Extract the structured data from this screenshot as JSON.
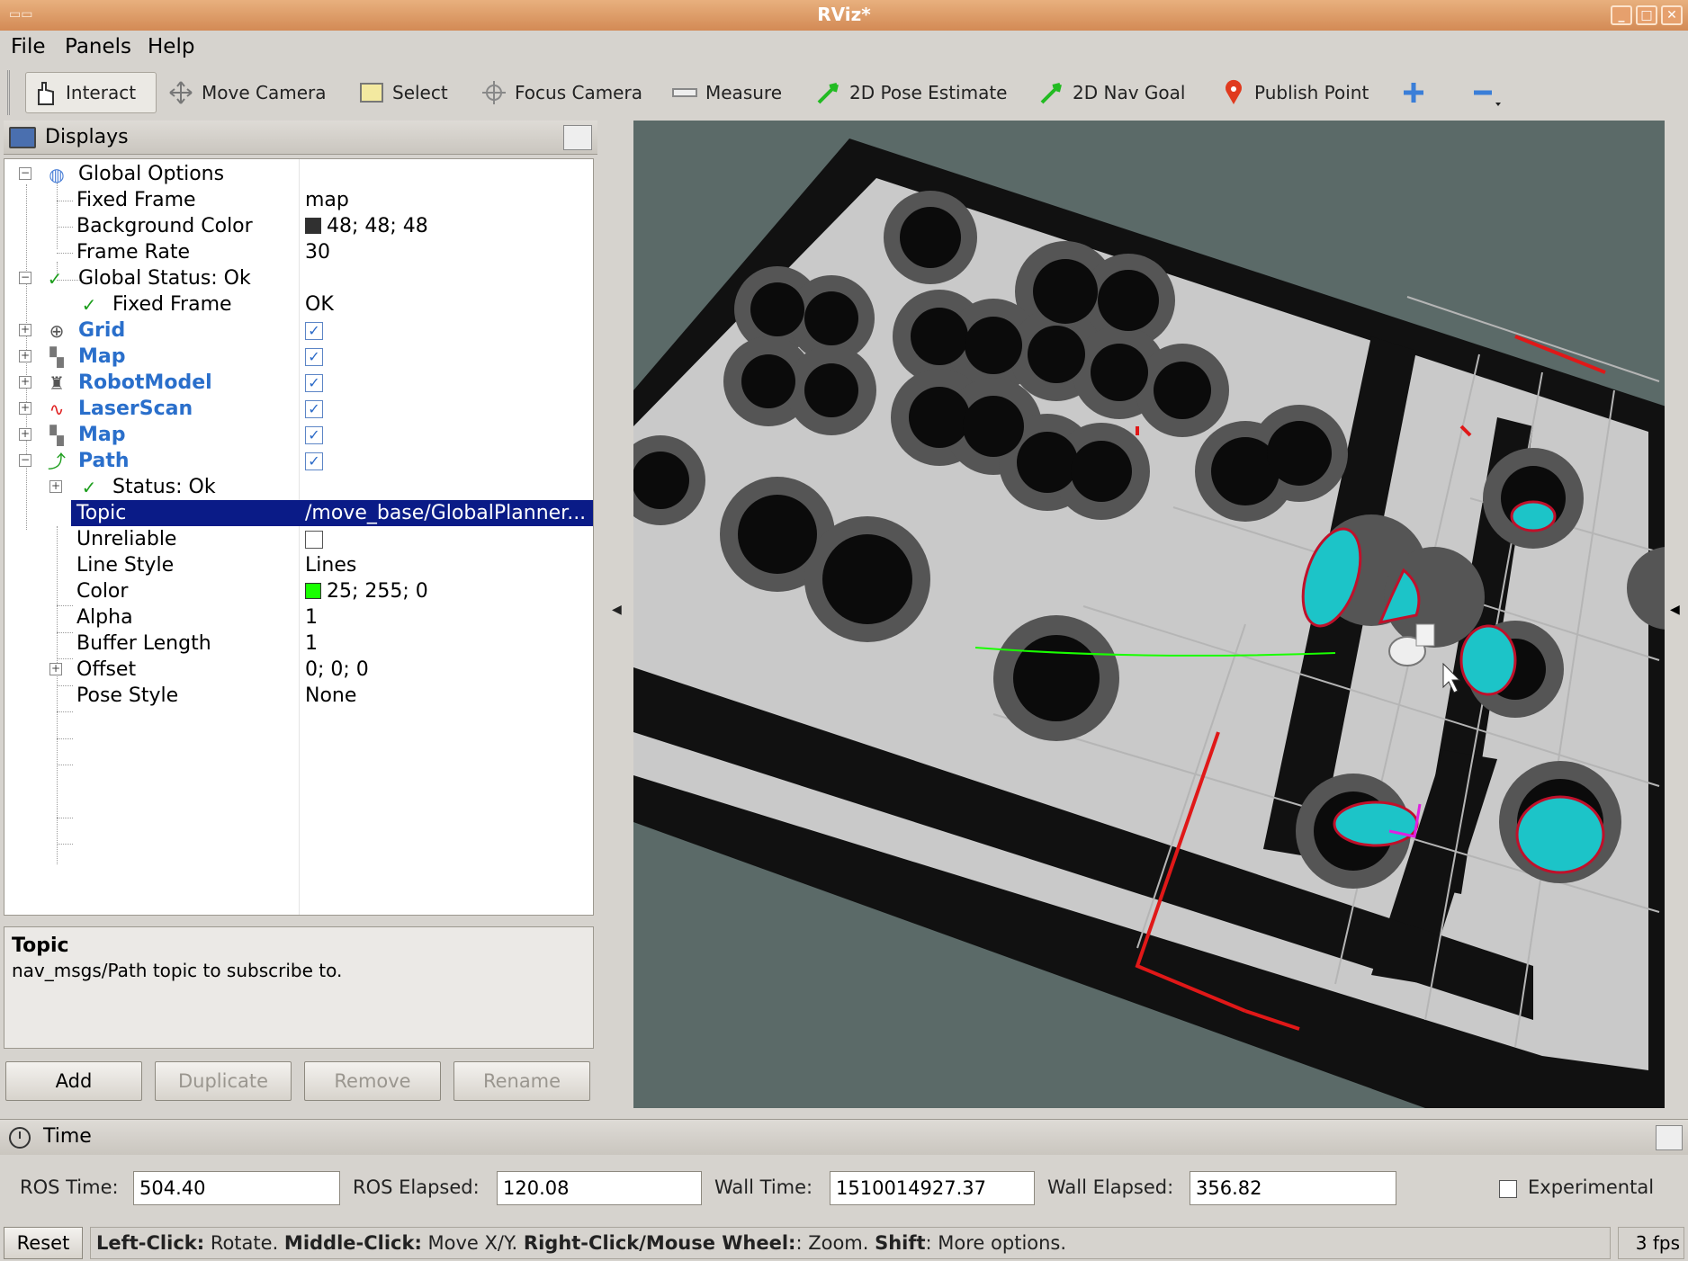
{
  "window": {
    "title": "RViz*"
  },
  "menu": {
    "file": "File",
    "panels": "Panels",
    "help": "Help"
  },
  "toolbar": {
    "interact": "Interact",
    "move_camera": "Move Camera",
    "select": "Select",
    "focus_camera": "Focus Camera",
    "measure": "Measure",
    "pose_estimate": "2D Pose Estimate",
    "nav_goal": "2D Nav Goal",
    "publish_point": "Publish Point"
  },
  "displays": {
    "title": "Displays",
    "global_options": "Global Options",
    "fixed_frame_label": "Fixed Frame",
    "fixed_frame_value": "map",
    "bg_color_label": "Background Color",
    "bg_color_value": "48; 48; 48",
    "bg_color_hex": "#303030",
    "frame_rate_label": "Frame Rate",
    "frame_rate_value": "30",
    "global_status": "Global Status: Ok",
    "status_fixed_frame": "Fixed Frame",
    "status_fixed_frame_value": "OK",
    "grid": "Grid",
    "map1": "Map",
    "robot_model": "RobotModel",
    "laser_scan": "LaserScan",
    "map2": "Map",
    "path": "Path",
    "path_status": "Status: Ok",
    "topic_label": "Topic",
    "topic_value": "/move_base/GlobalPlanner...",
    "unreliable_label": "Unreliable",
    "line_style_label": "Line Style",
    "line_style_value": "Lines",
    "color_label": "Color",
    "color_value": "25; 255; 0",
    "color_hex": "#19ff00",
    "alpha_label": "Alpha",
    "alpha_value": "1",
    "buffer_label": "Buffer Length",
    "buffer_value": "1",
    "offset_label": "Offset",
    "offset_value": "0; 0; 0",
    "pose_style_label": "Pose Style",
    "pose_style_value": "None"
  },
  "description": {
    "title": "Topic",
    "text": "nav_msgs/Path topic to subscribe to."
  },
  "buttons": {
    "add": "Add",
    "duplicate": "Duplicate",
    "remove": "Remove",
    "rename": "Rename"
  },
  "time": {
    "title": "Time",
    "ros_time_label": "ROS Time:",
    "ros_time": "504.40",
    "ros_elapsed_label": "ROS Elapsed:",
    "ros_elapsed": "120.08",
    "wall_time_label": "Wall Time:",
    "wall_time": "1510014927.37",
    "wall_elapsed_label": "Wall Elapsed:",
    "wall_elapsed": "356.82",
    "experimental": "Experimental"
  },
  "status": {
    "reset": "Reset",
    "left_click": "Left-Click:",
    "left_click_desc": " Rotate. ",
    "middle_click": "Middle-Click:",
    "middle_click_desc": " Move X/Y. ",
    "right_click": "Right-Click/Mouse Wheel:",
    "right_click_desc": ": Zoom. ",
    "shift": "Shift",
    "shift_desc": ": More options.",
    "fps": "3 fps"
  }
}
